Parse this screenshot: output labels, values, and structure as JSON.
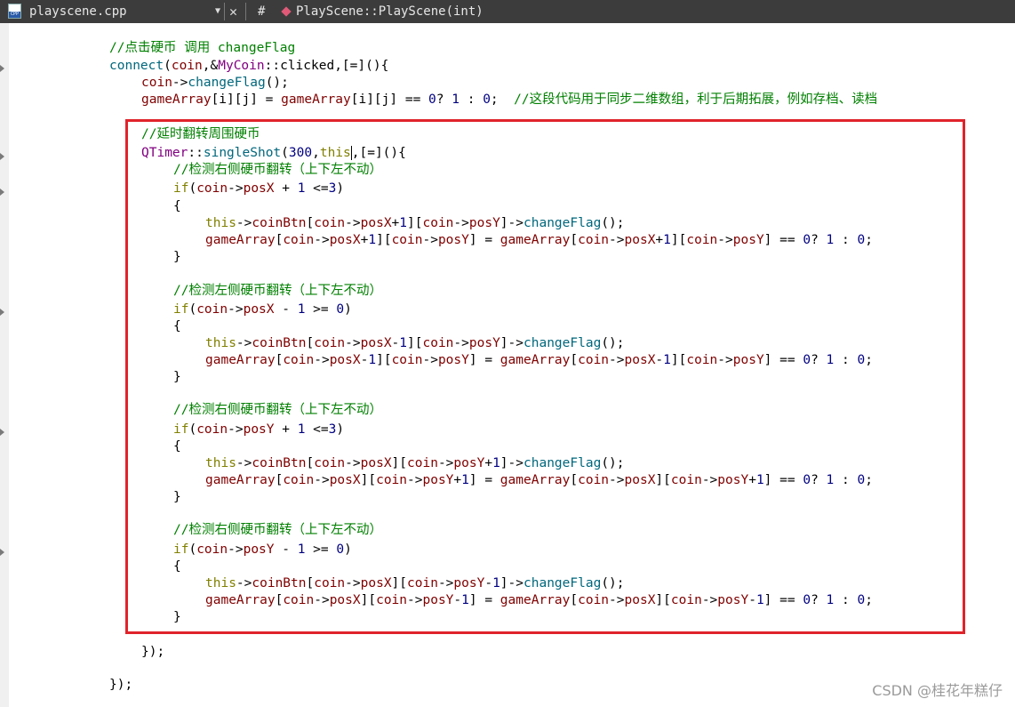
{
  "tab": {
    "file_name": "playscene.cpp",
    "dropdown_icon": "chevron-down-icon",
    "close_glyph": "✕",
    "hash": "#",
    "symbol": "PlayScene::PlayScene(int)"
  },
  "code_lines": [
    [
      [
        "comment",
        "//点击硬币 调用 changeFlag"
      ]
    ],
    [
      [
        "fn",
        "connect"
      ],
      [
        "plain",
        "("
      ],
      [
        "var",
        "coin"
      ],
      [
        "plain",
        ",&"
      ],
      [
        "cls",
        "MyCoin"
      ],
      [
        "plain",
        "::clicked,[=](){"
      ]
    ],
    [
      [
        "var",
        "coin"
      ],
      [
        "plain",
        "->"
      ],
      [
        "fn",
        "changeFlag"
      ],
      [
        "plain",
        "();"
      ]
    ],
    [
      [
        "var",
        "gameArray"
      ],
      [
        "plain",
        "[i][j] = "
      ],
      [
        "var",
        "gameArray"
      ],
      [
        "plain",
        "[i][j] == "
      ],
      [
        "num",
        "0"
      ],
      [
        "plain",
        "? "
      ],
      [
        "num",
        "1"
      ],
      [
        "plain",
        " : "
      ],
      [
        "num",
        "0"
      ],
      [
        "plain",
        ";  "
      ],
      [
        "comment",
        "//这段代码用于同步二维数组，利于后期拓展，例如存档、读档"
      ]
    ],
    [],
    [
      [
        "comment",
        "//延时翻转周围硬币"
      ]
    ],
    [
      [
        "cls",
        "QTimer"
      ],
      [
        "plain",
        "::"
      ],
      [
        "fn",
        "singleShot"
      ],
      [
        "plain",
        "("
      ],
      [
        "num",
        "300"
      ],
      [
        "plain",
        ","
      ],
      [
        "kw",
        "this"
      ],
      [
        "caret",
        ""
      ],
      [
        "plain",
        ",[=](){"
      ]
    ],
    [
      [
        "comment",
        "//检测右侧硬币翻转（上下左不动）"
      ]
    ],
    [
      [
        "kw",
        "if"
      ],
      [
        "plain",
        "("
      ],
      [
        "var",
        "coin"
      ],
      [
        "plain",
        "->"
      ],
      [
        "var",
        "posX"
      ],
      [
        "plain",
        " + "
      ],
      [
        "num",
        "1"
      ],
      [
        "plain",
        " <="
      ],
      [
        "num",
        "3"
      ],
      [
        "plain",
        ")"
      ]
    ],
    [
      [
        "plain",
        "{"
      ]
    ],
    [
      [
        "kw",
        "this"
      ],
      [
        "plain",
        "->"
      ],
      [
        "var",
        "coinBtn"
      ],
      [
        "plain",
        "["
      ],
      [
        "var",
        "coin"
      ],
      [
        "plain",
        "->"
      ],
      [
        "var",
        "posX"
      ],
      [
        "plain",
        "+"
      ],
      [
        "num",
        "1"
      ],
      [
        "plain",
        "]["
      ],
      [
        "var",
        "coin"
      ],
      [
        "plain",
        "->"
      ],
      [
        "var",
        "posY"
      ],
      [
        "plain",
        "]->"
      ],
      [
        "fn",
        "changeFlag"
      ],
      [
        "plain",
        "();"
      ]
    ],
    [
      [
        "var",
        "gameArray"
      ],
      [
        "plain",
        "["
      ],
      [
        "var",
        "coin"
      ],
      [
        "plain",
        "->"
      ],
      [
        "var",
        "posX"
      ],
      [
        "plain",
        "+"
      ],
      [
        "num",
        "1"
      ],
      [
        "plain",
        "]["
      ],
      [
        "var",
        "coin"
      ],
      [
        "plain",
        "->"
      ],
      [
        "var",
        "posY"
      ],
      [
        "plain",
        "] = "
      ],
      [
        "var",
        "gameArray"
      ],
      [
        "plain",
        "["
      ],
      [
        "var",
        "coin"
      ],
      [
        "plain",
        "->"
      ],
      [
        "var",
        "posX"
      ],
      [
        "plain",
        "+"
      ],
      [
        "num",
        "1"
      ],
      [
        "plain",
        "]["
      ],
      [
        "var",
        "coin"
      ],
      [
        "plain",
        "->"
      ],
      [
        "var",
        "posY"
      ],
      [
        "plain",
        "] == "
      ],
      [
        "num",
        "0"
      ],
      [
        "plain",
        "? "
      ],
      [
        "num",
        "1"
      ],
      [
        "plain",
        " : "
      ],
      [
        "num",
        "0"
      ],
      [
        "plain",
        ";"
      ]
    ],
    [
      [
        "plain",
        "}"
      ]
    ],
    [],
    [
      [
        "comment",
        "//检测左侧硬币翻转（上下左不动）"
      ]
    ],
    [
      [
        "kw",
        "if"
      ],
      [
        "plain",
        "("
      ],
      [
        "var",
        "coin"
      ],
      [
        "plain",
        "->"
      ],
      [
        "var",
        "posX"
      ],
      [
        "plain",
        " - "
      ],
      [
        "num",
        "1"
      ],
      [
        "plain",
        " >= "
      ],
      [
        "num",
        "0"
      ],
      [
        "plain",
        ")"
      ]
    ],
    [
      [
        "plain",
        "{"
      ]
    ],
    [
      [
        "kw",
        "this"
      ],
      [
        "plain",
        "->"
      ],
      [
        "var",
        "coinBtn"
      ],
      [
        "plain",
        "["
      ],
      [
        "var",
        "coin"
      ],
      [
        "plain",
        "->"
      ],
      [
        "var",
        "posX"
      ],
      [
        "plain",
        "-"
      ],
      [
        "num",
        "1"
      ],
      [
        "plain",
        "]["
      ],
      [
        "var",
        "coin"
      ],
      [
        "plain",
        "->"
      ],
      [
        "var",
        "posY"
      ],
      [
        "plain",
        "]->"
      ],
      [
        "fn",
        "changeFlag"
      ],
      [
        "plain",
        "();"
      ]
    ],
    [
      [
        "var",
        "gameArray"
      ],
      [
        "plain",
        "["
      ],
      [
        "var",
        "coin"
      ],
      [
        "plain",
        "->"
      ],
      [
        "var",
        "posX"
      ],
      [
        "plain",
        "-"
      ],
      [
        "num",
        "1"
      ],
      [
        "plain",
        "]["
      ],
      [
        "var",
        "coin"
      ],
      [
        "plain",
        "->"
      ],
      [
        "var",
        "posY"
      ],
      [
        "plain",
        "] = "
      ],
      [
        "var",
        "gameArray"
      ],
      [
        "plain",
        "["
      ],
      [
        "var",
        "coin"
      ],
      [
        "plain",
        "->"
      ],
      [
        "var",
        "posX"
      ],
      [
        "plain",
        "-"
      ],
      [
        "num",
        "1"
      ],
      [
        "plain",
        "]["
      ],
      [
        "var",
        "coin"
      ],
      [
        "plain",
        "->"
      ],
      [
        "var",
        "posY"
      ],
      [
        "plain",
        "] == "
      ],
      [
        "num",
        "0"
      ],
      [
        "plain",
        "? "
      ],
      [
        "num",
        "1"
      ],
      [
        "plain",
        " : "
      ],
      [
        "num",
        "0"
      ],
      [
        "plain",
        ";"
      ]
    ],
    [
      [
        "plain",
        "}"
      ]
    ],
    [],
    [
      [
        "comment",
        "//检测右侧硬币翻转（上下左不动）"
      ]
    ],
    [
      [
        "kw",
        "if"
      ],
      [
        "plain",
        "("
      ],
      [
        "var",
        "coin"
      ],
      [
        "plain",
        "->"
      ],
      [
        "var",
        "posY"
      ],
      [
        "plain",
        " + "
      ],
      [
        "num",
        "1"
      ],
      [
        "plain",
        " <="
      ],
      [
        "num",
        "3"
      ],
      [
        "plain",
        ")"
      ]
    ],
    [
      [
        "plain",
        "{"
      ]
    ],
    [
      [
        "kw",
        "this"
      ],
      [
        "plain",
        "->"
      ],
      [
        "var",
        "coinBtn"
      ],
      [
        "plain",
        "["
      ],
      [
        "var",
        "coin"
      ],
      [
        "plain",
        "->"
      ],
      [
        "var",
        "posX"
      ],
      [
        "plain",
        "]["
      ],
      [
        "var",
        "coin"
      ],
      [
        "plain",
        "->"
      ],
      [
        "var",
        "posY"
      ],
      [
        "plain",
        "+"
      ],
      [
        "num",
        "1"
      ],
      [
        "plain",
        "]->"
      ],
      [
        "fn",
        "changeFlag"
      ],
      [
        "plain",
        "();"
      ]
    ],
    [
      [
        "var",
        "gameArray"
      ],
      [
        "plain",
        "["
      ],
      [
        "var",
        "coin"
      ],
      [
        "plain",
        "->"
      ],
      [
        "var",
        "posX"
      ],
      [
        "plain",
        "]["
      ],
      [
        "var",
        "coin"
      ],
      [
        "plain",
        "->"
      ],
      [
        "var",
        "posY"
      ],
      [
        "plain",
        "+"
      ],
      [
        "num",
        "1"
      ],
      [
        "plain",
        "] = "
      ],
      [
        "var",
        "gameArray"
      ],
      [
        "plain",
        "["
      ],
      [
        "var",
        "coin"
      ],
      [
        "plain",
        "->"
      ],
      [
        "var",
        "posX"
      ],
      [
        "plain",
        "]["
      ],
      [
        "var",
        "coin"
      ],
      [
        "plain",
        "->"
      ],
      [
        "var",
        "posY"
      ],
      [
        "plain",
        "+"
      ],
      [
        "num",
        "1"
      ],
      [
        "plain",
        "] == "
      ],
      [
        "num",
        "0"
      ],
      [
        "plain",
        "? "
      ],
      [
        "num",
        "1"
      ],
      [
        "plain",
        " : "
      ],
      [
        "num",
        "0"
      ],
      [
        "plain",
        ";"
      ]
    ],
    [
      [
        "plain",
        "}"
      ]
    ],
    [],
    [
      [
        "comment",
        "//检测右侧硬币翻转（上下左不动）"
      ]
    ],
    [
      [
        "kw",
        "if"
      ],
      [
        "plain",
        "("
      ],
      [
        "var",
        "coin"
      ],
      [
        "plain",
        "->"
      ],
      [
        "var",
        "posY"
      ],
      [
        "plain",
        " - "
      ],
      [
        "num",
        "1"
      ],
      [
        "plain",
        " >= "
      ],
      [
        "num",
        "0"
      ],
      [
        "plain",
        ")"
      ]
    ],
    [
      [
        "plain",
        "{"
      ]
    ],
    [
      [
        "kw",
        "this"
      ],
      [
        "plain",
        "->"
      ],
      [
        "var",
        "coinBtn"
      ],
      [
        "plain",
        "["
      ],
      [
        "var",
        "coin"
      ],
      [
        "plain",
        "->"
      ],
      [
        "var",
        "posX"
      ],
      [
        "plain",
        "]["
      ],
      [
        "var",
        "coin"
      ],
      [
        "plain",
        "->"
      ],
      [
        "var",
        "posY"
      ],
      [
        "plain",
        "-"
      ],
      [
        "num",
        "1"
      ],
      [
        "plain",
        "]->"
      ],
      [
        "fn",
        "changeFlag"
      ],
      [
        "plain",
        "();"
      ]
    ],
    [
      [
        "var",
        "gameArray"
      ],
      [
        "plain",
        "["
      ],
      [
        "var",
        "coin"
      ],
      [
        "plain",
        "->"
      ],
      [
        "var",
        "posX"
      ],
      [
        "plain",
        "]["
      ],
      [
        "var",
        "coin"
      ],
      [
        "plain",
        "->"
      ],
      [
        "var",
        "posY"
      ],
      [
        "plain",
        "-"
      ],
      [
        "num",
        "1"
      ],
      [
        "plain",
        "] = "
      ],
      [
        "var",
        "gameArray"
      ],
      [
        "plain",
        "["
      ],
      [
        "var",
        "coin"
      ],
      [
        "plain",
        "->"
      ],
      [
        "var",
        "posX"
      ],
      [
        "plain",
        "]["
      ],
      [
        "var",
        "coin"
      ],
      [
        "plain",
        "->"
      ],
      [
        "var",
        "posY"
      ],
      [
        "plain",
        "-"
      ],
      [
        "num",
        "1"
      ],
      [
        "plain",
        "] == "
      ],
      [
        "num",
        "0"
      ],
      [
        "plain",
        "? "
      ],
      [
        "num",
        "1"
      ],
      [
        "plain",
        " : "
      ],
      [
        "num",
        "0"
      ],
      [
        "plain",
        ";"
      ]
    ],
    [
      [
        "plain",
        "}"
      ]
    ],
    [],
    [
      [
        "plain",
        "});"
      ]
    ],
    [],
    [
      [
        "plain",
        "});"
      ]
    ]
  ],
  "colors": {
    "comment": "#008000",
    "function": "#00677c",
    "variable": "#800000",
    "keyword": "#808000",
    "class": "#800080",
    "number": "#000080",
    "highlight_border": "#e0232b",
    "toolbar_bg": "#3c3c3c"
  },
  "watermark": "CSDN @桂花年糕仔"
}
